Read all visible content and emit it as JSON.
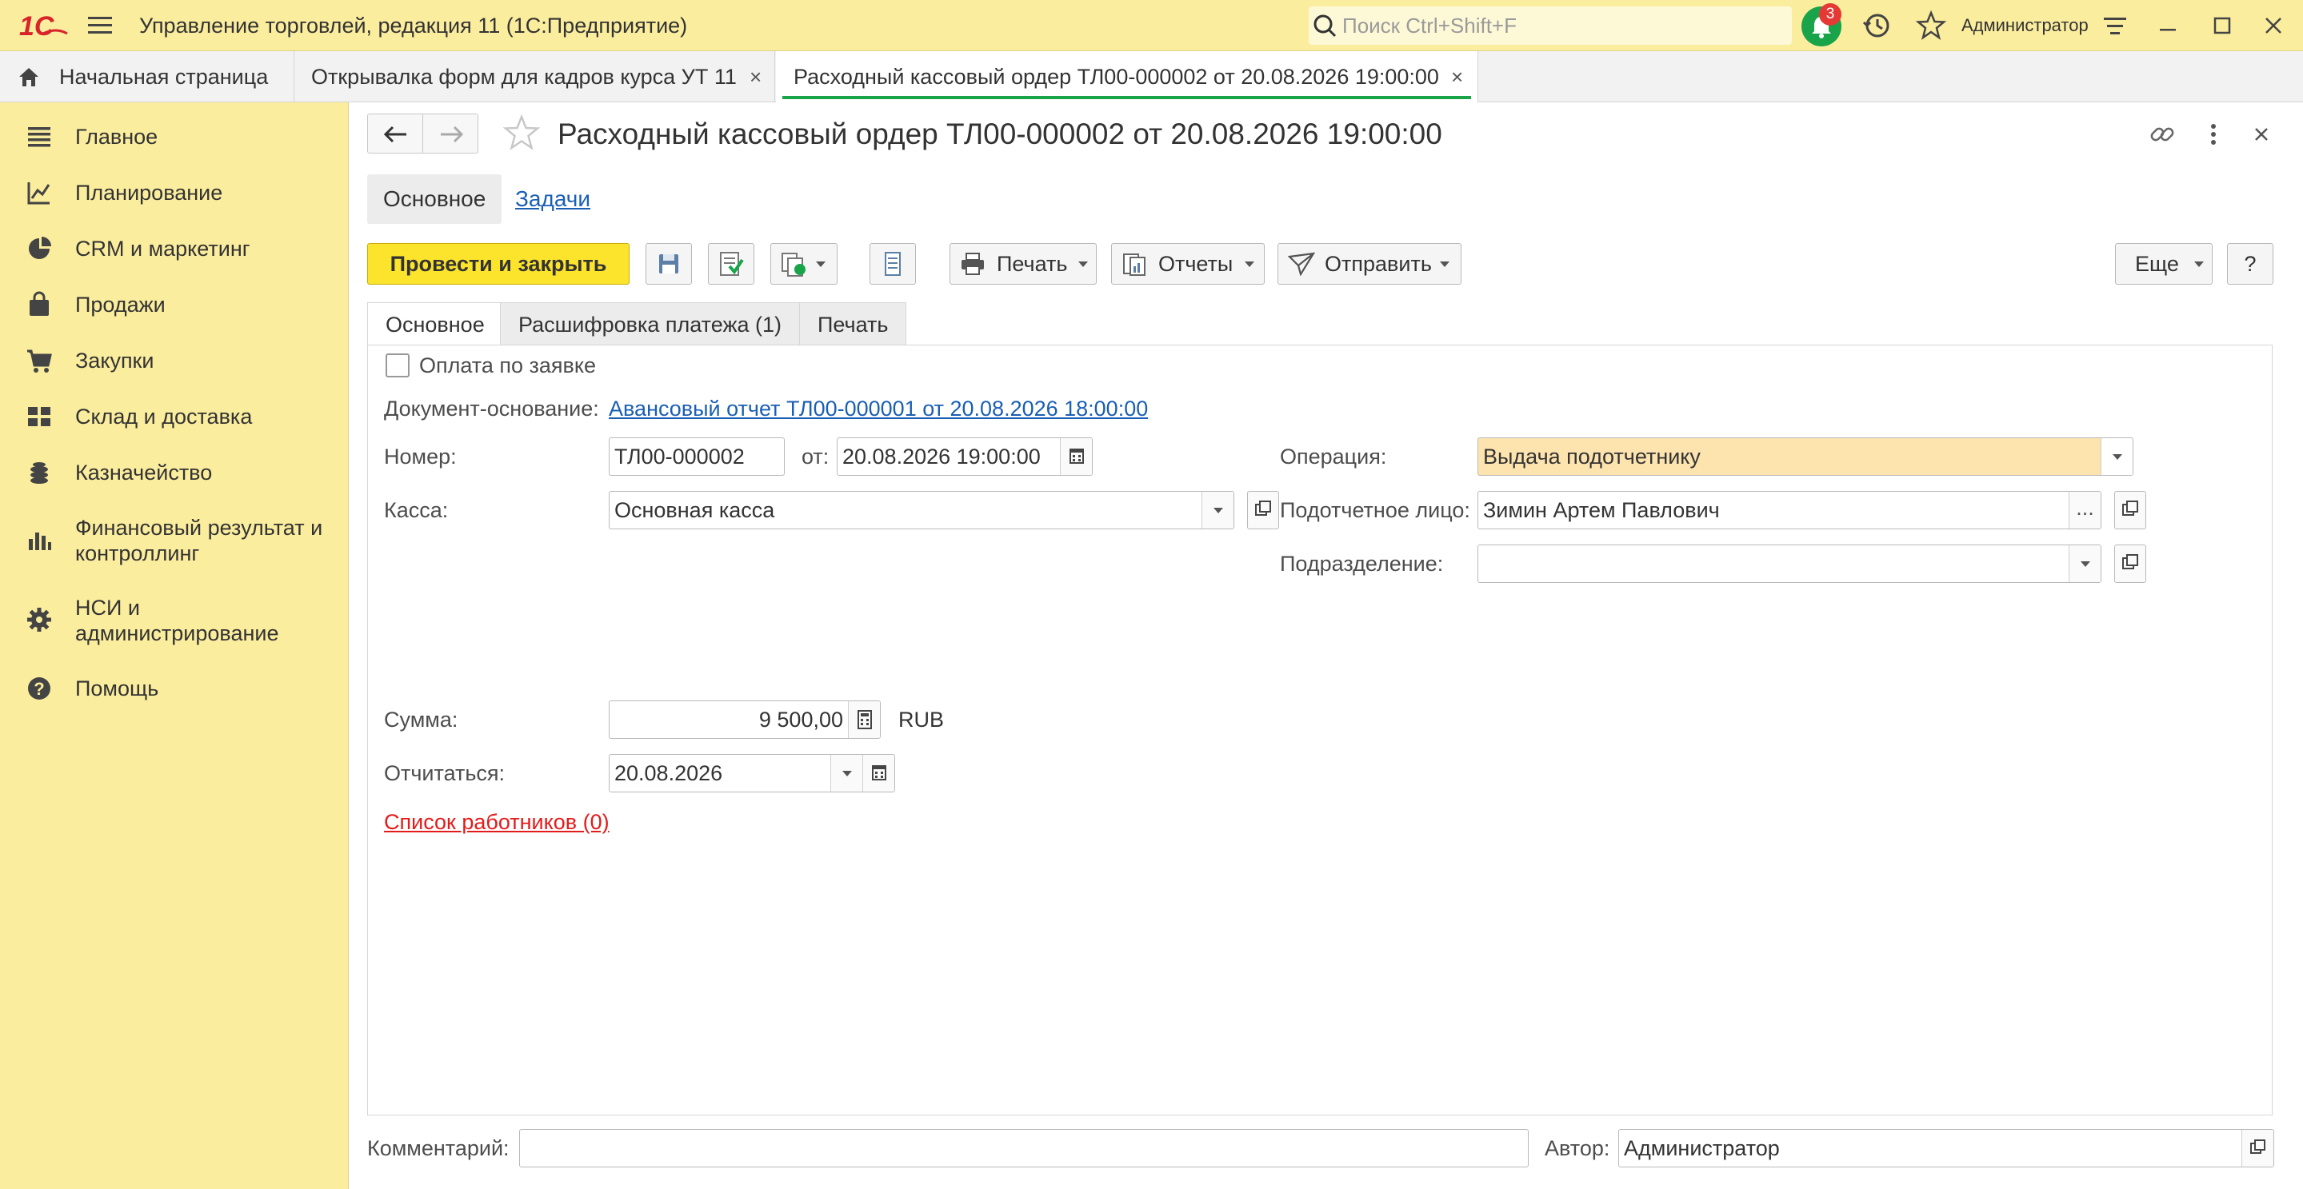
{
  "app": {
    "title": "Управление торговлей, редакция 11  (1С:Предприятие)",
    "search_placeholder": "Поиск Ctrl+Shift+F",
    "notifications_count": "3",
    "user": "Администратор",
    "logo_text": "1С"
  },
  "tabs": [
    {
      "label": "Начальная страница"
    },
    {
      "label": "Открывалка форм для кадров курса УТ 11"
    },
    {
      "label": "Расходный кассовый ордер ТЛ00-000002 от 20.08.2026 19:00:00"
    }
  ],
  "sidebar": {
    "items": [
      {
        "label": "Главное",
        "icon": "menu-lines-icon"
      },
      {
        "label": "Планирование",
        "icon": "planning-icon"
      },
      {
        "label": "CRM и маркетинг",
        "icon": "pie-chart-icon"
      },
      {
        "label": "Продажи",
        "icon": "shopping-bag-icon"
      },
      {
        "label": "Закупки",
        "icon": "cart-icon"
      },
      {
        "label": "Склад и доставка",
        "icon": "warehouse-icon"
      },
      {
        "label": "Казначейство",
        "icon": "coins-icon"
      },
      {
        "label": "Финансовый результат и",
        "label2": "контроллинг",
        "icon": "bar-chart-icon"
      },
      {
        "label": "НСИ и",
        "label2": "администрирование",
        "icon": "gear-icon"
      },
      {
        "label": "Помощь",
        "icon": "help-icon"
      }
    ]
  },
  "document": {
    "title": "Расходный кассовый ордер ТЛ00-000002 от 20.08.2026 19:00:00",
    "subtabs": {
      "main": "Основное",
      "tasks": "Задачи"
    },
    "toolbar": {
      "post_close": "Провести и закрыть",
      "print": "Печать",
      "reports": "Отчеты",
      "send": "Отправить",
      "more": "Еще",
      "help": "?"
    },
    "form_tabs": [
      "Основное",
      "Расшифровка платежа (1)",
      "Печать"
    ],
    "form": {
      "pay_by_request": "Оплата по заявке",
      "basis_label": "Документ-основание:",
      "basis_link": "Авансовый отчет ТЛ00-000001 от 20.08.2026 18:00:00",
      "number_label": "Номер:",
      "number_value": "ТЛ00-000002",
      "date_label": "от:",
      "date_value": "20.08.2026 19:00:00",
      "operation_label": "Операция:",
      "operation_value": "Выдача подотчетнику",
      "cash_label": "Касса:",
      "cash_value": "Основная касса",
      "person_label": "Подотчетное лицо:",
      "person_value": "Зимин Артем Павлович",
      "department_label": "Подразделение:",
      "department_value": "",
      "sum_label": "Сумма:",
      "sum_value": "9 500,00",
      "currency": "RUB",
      "report_label": "Отчитаться:",
      "report_value": "20.08.2026",
      "employees_link": "Список работников (0)"
    },
    "footer": {
      "comment_label": "Комментарий:",
      "comment_value": "",
      "author_label": "Автор:",
      "author_value": "Администратор"
    }
  },
  "colors": {
    "accent_yellow": "#fce32c",
    "sidebar_bg": "#fbed9e",
    "active_tab_underline": "#1aa44a",
    "link_blue": "#1a5fb4",
    "link_red": "#e41b1b",
    "logo_red": "#d8232a"
  }
}
